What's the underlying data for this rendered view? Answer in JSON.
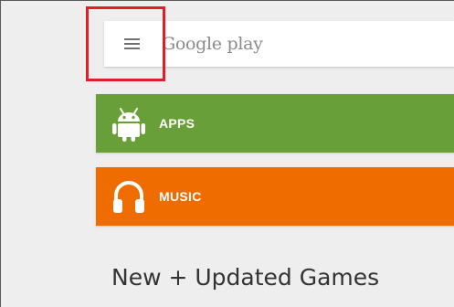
{
  "search": {
    "brand_text": "Google play"
  },
  "categories": [
    {
      "label": "APPS",
      "icon": "android-icon",
      "color": "#689f38"
    },
    {
      "label": "MUSIC",
      "icon": "headphones-icon",
      "color": "#ef6c00"
    }
  ],
  "highlight_color": "#e01e26",
  "section": {
    "title": "New + Updated Games"
  }
}
